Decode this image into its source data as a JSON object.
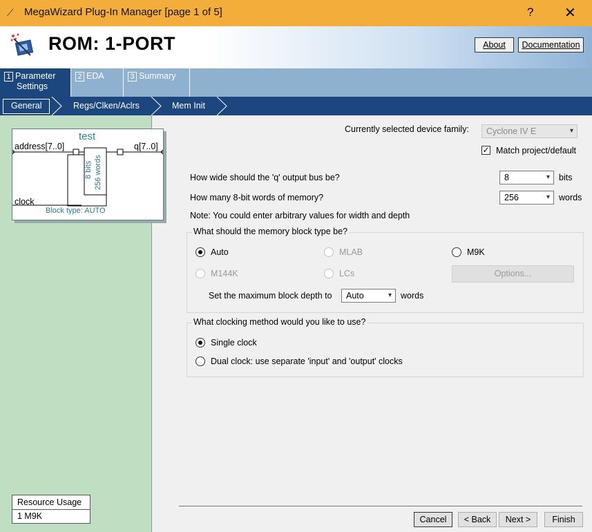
{
  "window": {
    "title": "MegaWizard Plug-In Manager [page 1 of 5]",
    "help": "?",
    "close": "✕"
  },
  "header": {
    "title": "ROM: 1-PORT",
    "about": "About",
    "documentation": "Documentation"
  },
  "tabs": [
    {
      "num": "1",
      "label": "Parameter",
      "label2": "Settings"
    },
    {
      "num": "2",
      "label": "EDA"
    },
    {
      "num": "3",
      "label": "Summary"
    }
  ],
  "subnav": [
    "General",
    "Regs/Clken/Aclrs",
    "Mem Init"
  ],
  "symbol": {
    "name": "test",
    "address": "address[7..0]",
    "q": "q[7..0]",
    "clock": "clock",
    "bits": "8 bits",
    "words": "256 words",
    "block_type": "Block type: AUTO"
  },
  "resource": {
    "title": "Resource Usage",
    "value": "1 M9K"
  },
  "device": {
    "label": "Currently selected device family:",
    "value": "Cyclone IV E",
    "match": "Match project/default",
    "match_checked": true
  },
  "width": {
    "label": "How wide should the 'q' output bus be?",
    "value": "8",
    "unit": "bits"
  },
  "depth": {
    "label": "How many 8-bit words of memory?",
    "value": "256",
    "unit": "words"
  },
  "note": "Note: You could enter arbitrary values for width and depth",
  "memblock": {
    "legend": "What should the memory block type be?",
    "options": [
      "Auto",
      "MLAB",
      "M9K",
      "M144K",
      "LCs"
    ],
    "selected": "Auto",
    "options_button": "Options...",
    "max_depth_label": "Set the maximum block depth to",
    "max_depth_value": "Auto",
    "max_depth_unit": "words"
  },
  "clocking": {
    "legend": "What clocking method would you like to use?",
    "single": "Single clock",
    "dual": "Dual clock: use separate 'input' and 'output' clocks",
    "selected": "single"
  },
  "buttons": {
    "cancel": "Cancel",
    "back": "< Back",
    "next": "Next >",
    "finish": "Finish"
  },
  "colors": {
    "titlebar": "#f3ad3a",
    "subnav": "#1b467e",
    "tabs": "#8fb1d0",
    "leftpane": "#c0dec2"
  }
}
